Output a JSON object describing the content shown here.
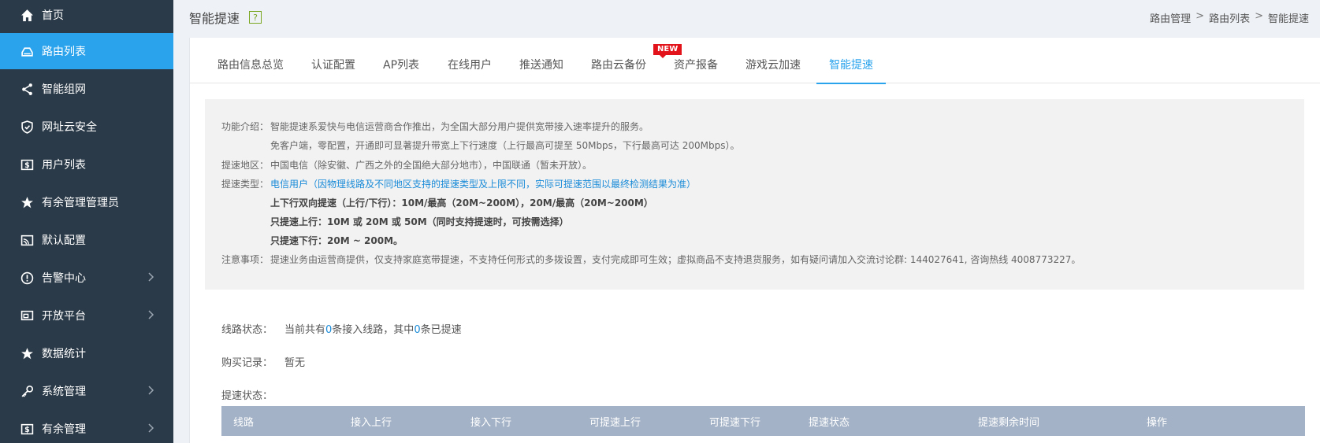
{
  "sidebar": {
    "items": [
      {
        "label": "首页",
        "icon": "home-icon"
      },
      {
        "label": "路由列表",
        "icon": "router-icon",
        "active": true
      },
      {
        "label": "智能组网",
        "icon": "share-icon"
      },
      {
        "label": "网址云安全",
        "icon": "shield-icon"
      },
      {
        "label": "用户列表",
        "icon": "dollar-card-icon"
      },
      {
        "label": "有余管理管理员",
        "icon": "star-icon"
      },
      {
        "label": "默认配置",
        "icon": "cast-icon"
      },
      {
        "label": "告警中心",
        "icon": "alert-icon"
      },
      {
        "label": "开放平台",
        "icon": "screen-icon"
      },
      {
        "label": "数据统计",
        "icon": "star-icon"
      },
      {
        "label": "系统管理",
        "icon": "key-icon"
      },
      {
        "label": "有余管理",
        "icon": "dollar-card-icon"
      }
    ]
  },
  "header": {
    "title": "智能提速",
    "help": "?",
    "breadcrumb": [
      "路由管理",
      "路由列表",
      "智能提速"
    ],
    "sep": ">"
  },
  "tabs": [
    "路由信息总览",
    "认证配置",
    "AP列表",
    "在线用户",
    "推送通知",
    "路由云备份",
    "资产报备",
    "游戏云加速",
    "智能提速"
  ],
  "tab_badge": "NEW",
  "info": {
    "intro_label": "功能介绍：",
    "intro_1": "智能提速系爱快与电信运营商合作推出，为全国大部分用户提供宽带接入速率提升的服务。",
    "intro_2": "免客户端，零配置，开通即可显著提升带宽上下行速度（上行最高可提至 50Mbps，下行最高可达 200Mbps）。",
    "region_label": "提速地区：",
    "region": "中国电信（除安徽、广西之外的全国绝大部分地市），中国联通（暂未开放）。",
    "type_label": "提速类型：",
    "type_1": "电信用户（因物理线路及不同地区支持的提速类型及上限不同，实际可提速范围以最终检测结果为准）",
    "type_2": "上下行双向提速（上行/下行）：10M/最高（20M~200M），20M/最高（20M~200M）",
    "type_3": "只提速上行：10M 或 20M 或 50M（同时支持提速时，可按需选择）",
    "type_4": "只提速下行：20M ~ 200M。",
    "note_label": "注意事项：",
    "note": "提速业务由运营商提供，仅支持家庭宽带提速，不支持任何形式的多拨设置，支付完成即可生效；虚拟商品不支持退货服务，如有疑问请加入交流讨论群: 144027641, 咨询热线 4008773227。"
  },
  "status": {
    "line_label": "线路状态：",
    "line_pre": "当前共有",
    "line_total": "0",
    "line_mid": "条接入线路，其中",
    "line_boosted": "0",
    "line_post": "条已提速",
    "purchase_label": "购买记录：",
    "purchase_value": "暂无",
    "speed_label": "提速状态："
  },
  "table": {
    "headers": [
      "线路",
      "接入上行",
      "接入下行",
      "可提速上行",
      "可提速下行",
      "提速状态",
      "提速剩余时间",
      "操作"
    ]
  }
}
